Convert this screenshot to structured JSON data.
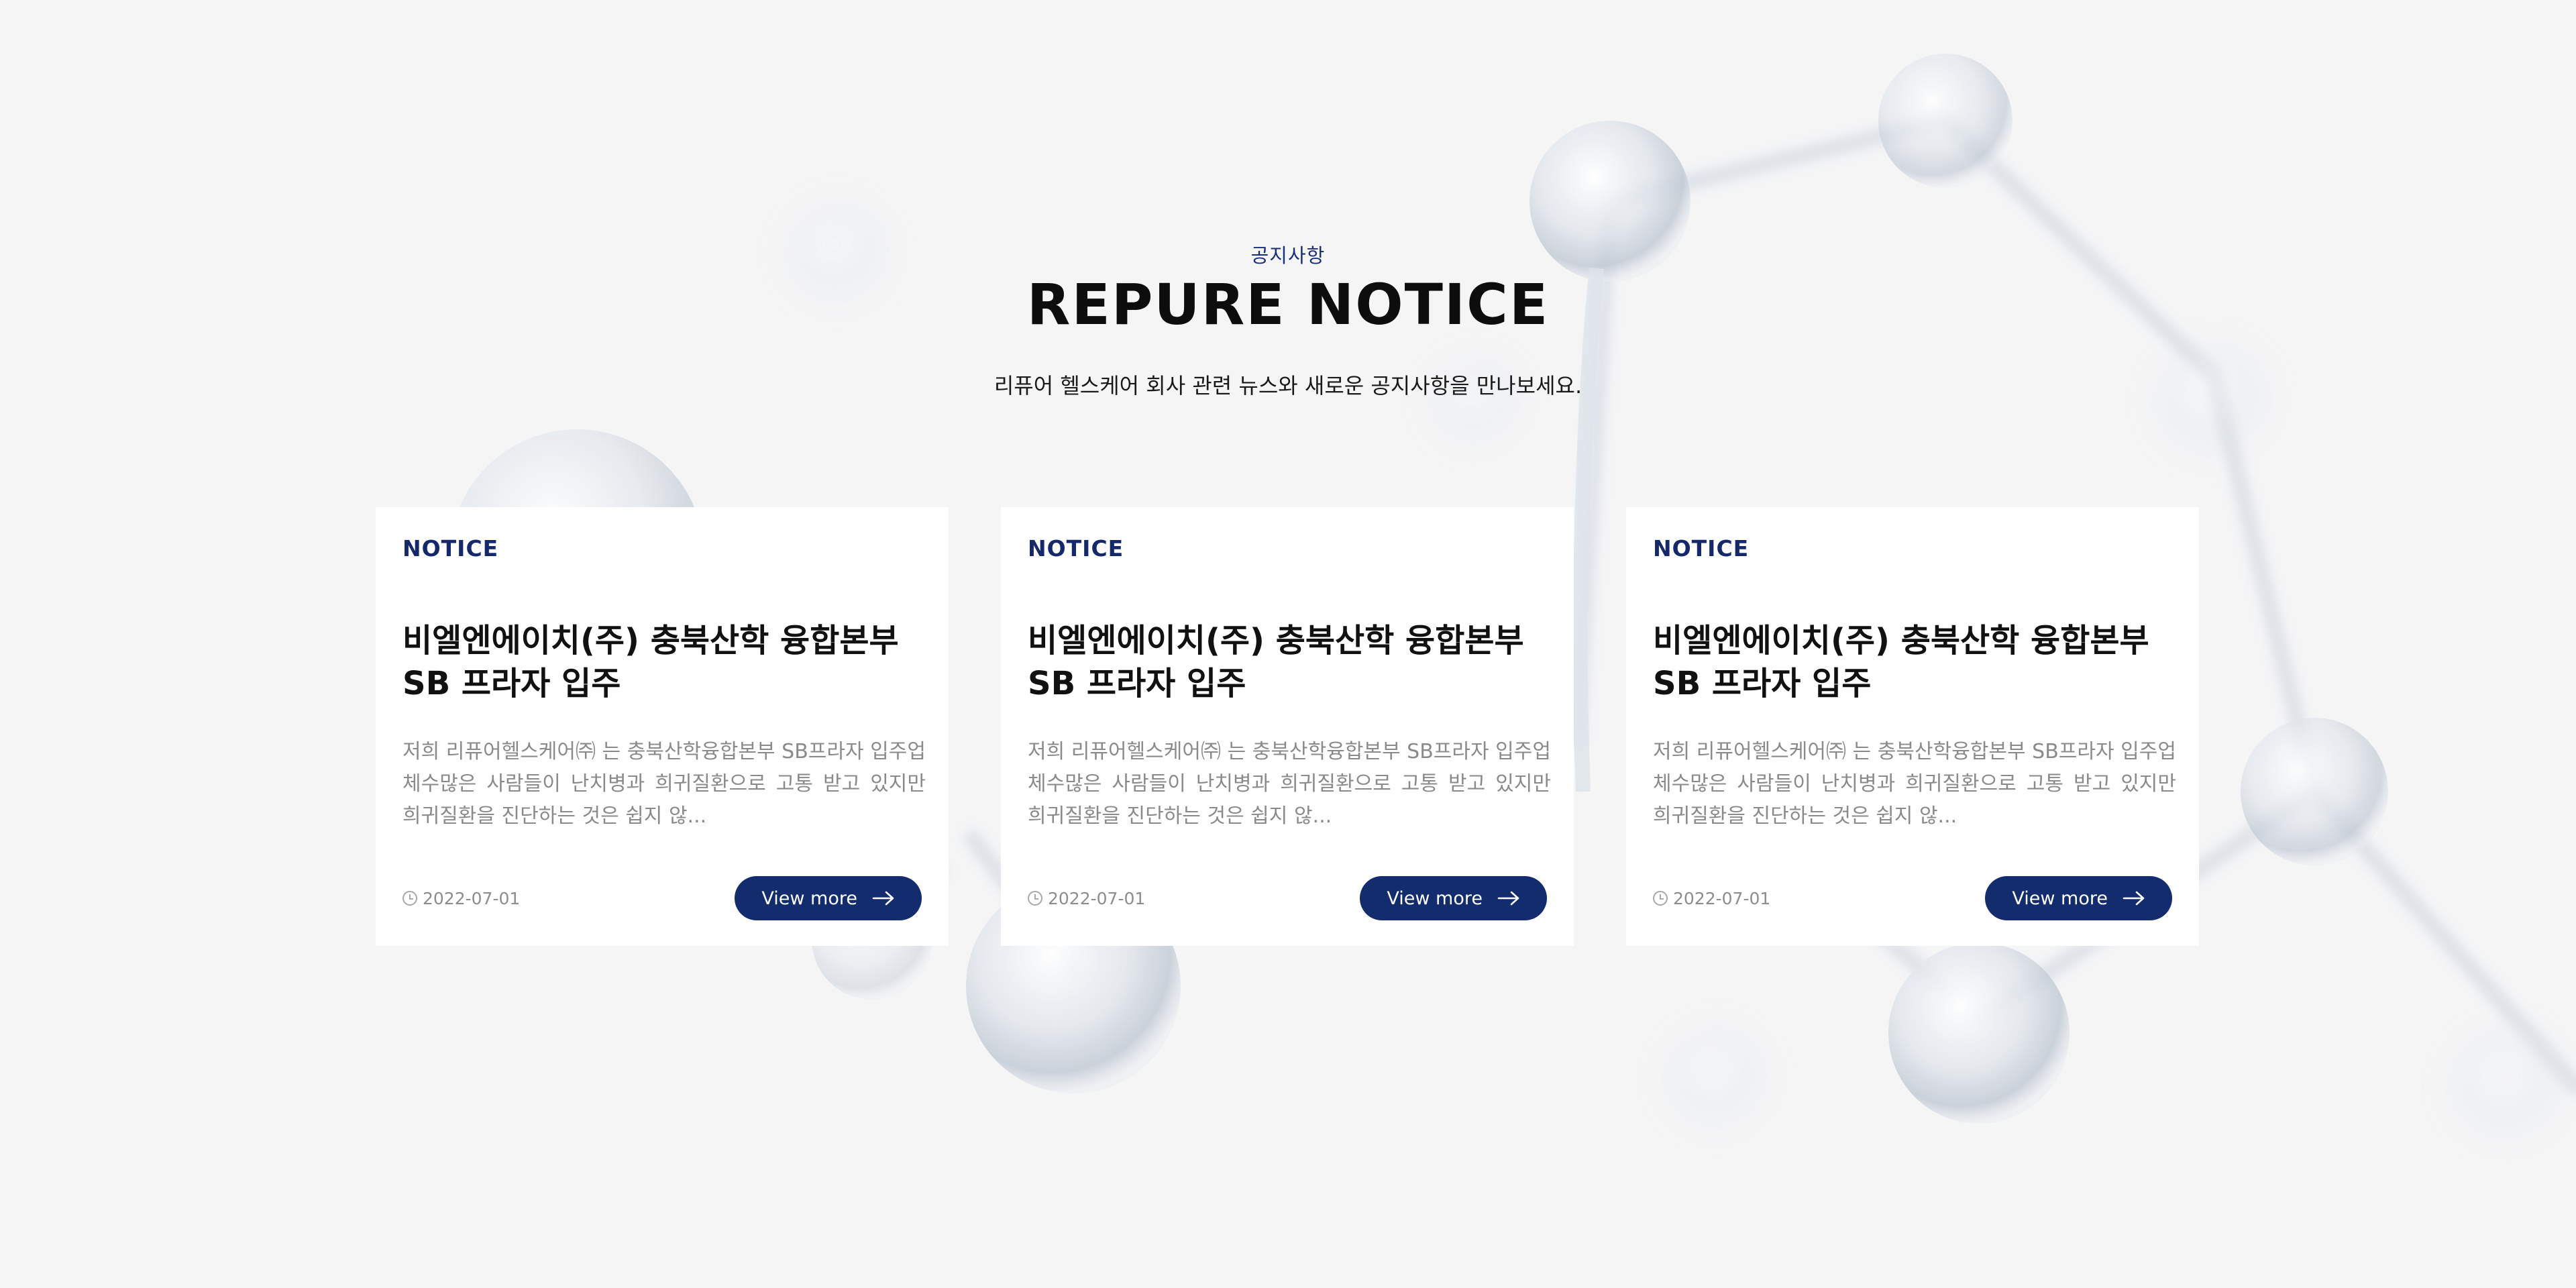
{
  "header": {
    "eyebrow": "공지사항",
    "title": "REPURE NOTICE",
    "subtitle": "리퓨어 헬스케어 회사 관련 뉴스와 새로운 공지사항을 만나보세요."
  },
  "cards": [
    {
      "tag": "NOTICE",
      "title": "비엘엔에이치(주) 충북산학 융합본부 SB 프라자 입주",
      "body": "저희 리퓨어헬스케어㈜ 는 충북산학융합본부 SB프라자 입주업체수많은 사람들이 난치병과 희귀질환으로 고통 받고 있지만 희귀질환을 진단하는 것은 쉽지 않...",
      "date": "2022-07-01",
      "button": "View more"
    },
    {
      "tag": "NOTICE",
      "title": "비엘엔에이치(주) 충북산학 융합본부 SB 프라자 입주",
      "body": "저희 리퓨어헬스케어㈜ 는 충북산학융합본부 SB프라자 입주업체수많은 사람들이 난치병과 희귀질환으로 고통 받고 있지만 희귀질환을 진단하는 것은 쉽지 않...",
      "date": "2022-07-01",
      "button": "View more"
    },
    {
      "tag": "NOTICE",
      "title": "비엘엔에이치(주) 충북산학 융합본부 SB 프라자 입주",
      "body": "저희 리퓨어헬스케어㈜ 는 충북산학융합본부 SB프라자 입주업체수많은 사람들이 난치병과 희귀질환으로 고통 받고 있지만 희귀질환을 진단하는 것은 쉽지 않...",
      "date": "2022-07-01",
      "button": "View more"
    }
  ],
  "colors": {
    "accent": "#132c6e",
    "background": "#f5f5f6"
  },
  "icons": {
    "date": "clock-icon",
    "button": "arrow-right-icon"
  }
}
